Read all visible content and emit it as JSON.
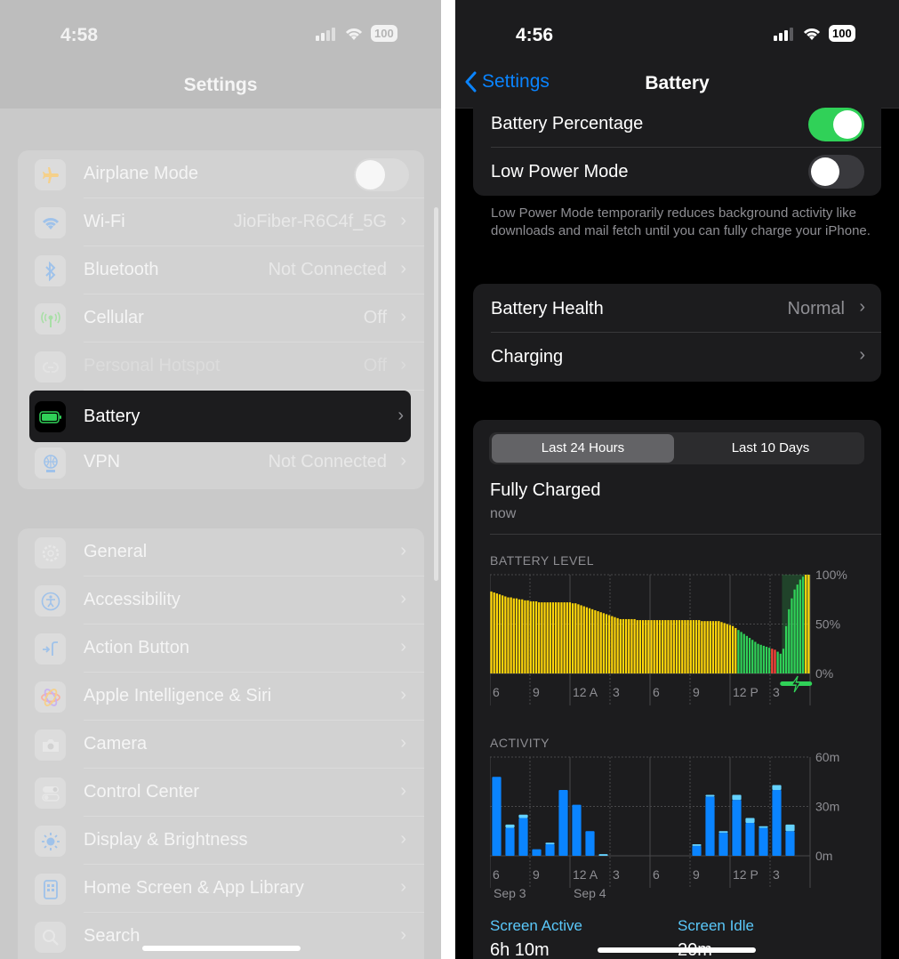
{
  "left": {
    "status": {
      "time": "4:58",
      "battery": "100"
    },
    "title": "Settings",
    "group1": [
      {
        "label": "Airplane Mode",
        "value": "",
        "kind": "toggle-off"
      },
      {
        "label": "Wi-Fi",
        "value": "JioFiber-R6C4f_5G",
        "kind": "chevron"
      },
      {
        "label": "Bluetooth",
        "value": "Not Connected",
        "kind": "chevron"
      },
      {
        "label": "Cellular",
        "value": "Off",
        "kind": "chevron"
      },
      {
        "label": "Personal Hotspot",
        "value": "Off",
        "kind": "chevron-dim"
      },
      {
        "label": "Battery",
        "value": "",
        "kind": "highlight"
      },
      {
        "label": "VPN",
        "value": "Not Connected",
        "kind": "chevron"
      }
    ],
    "group2": [
      {
        "label": "General"
      },
      {
        "label": "Accessibility"
      },
      {
        "label": "Action Button"
      },
      {
        "label": "Apple Intelligence & Siri"
      },
      {
        "label": "Camera"
      },
      {
        "label": "Control Center"
      },
      {
        "label": "Display & Brightness"
      },
      {
        "label": "Home Screen & App Library"
      },
      {
        "label": "Search"
      }
    ],
    "icons": [
      "airplane-icon",
      "wifi-icon",
      "bluetooth-icon",
      "cellular-icon",
      "hotspot-icon",
      "battery-icon",
      "vpn-icon",
      "gear-icon",
      "accessibility-icon",
      "action-button-icon",
      "siri-icon",
      "camera-icon",
      "control-center-icon",
      "brightness-icon",
      "home-screen-icon",
      "search-icon"
    ]
  },
  "right": {
    "status": {
      "time": "4:56",
      "battery": "100"
    },
    "nav": {
      "back": "Settings",
      "title": "Battery"
    },
    "toggles": [
      {
        "label": "Battery Percentage",
        "on": true
      },
      {
        "label": "Low Power Mode",
        "on": false
      }
    ],
    "footnote": "Low Power Mode temporarily reduces background activity like downloads and mail fetch until you can fully charge your iPhone.",
    "health": {
      "label": "Battery Health",
      "value": "Normal"
    },
    "charging": {
      "label": "Charging"
    },
    "segments": {
      "selected": "Last 24 Hours",
      "other": "Last 10 Days"
    },
    "charged": {
      "title": "Fully Charged",
      "subtitle": "now"
    },
    "legend": {
      "active_label": "Screen Active",
      "active_value": "6h 10m",
      "idle_label": "Screen Idle",
      "idle_value": "20m"
    }
  },
  "colors": {
    "accent": "#0a84ff",
    "toggle_on": "#30d158",
    "bar_normal": "#ffd60a",
    "bar_low_power": "#30d158",
    "bar_critical": "#ff453a",
    "activity_active": "#0a84ff",
    "activity_idle": "#64d2ff"
  },
  "chart_data": [
    {
      "type": "bar",
      "title": "BATTERY LEVEL",
      "xlabel": "",
      "ylabel": "",
      "ylim": [
        0,
        100
      ],
      "ytick_labels": [
        "100%",
        "50%",
        "0%"
      ],
      "xtick_labels": [
        "6",
        "9",
        "12 A",
        "3",
        "6",
        "9",
        "12 P",
        "3"
      ],
      "values": [
        83,
        82,
        81,
        80,
        79,
        78,
        77,
        77,
        76,
        76,
        75,
        75,
        74,
        74,
        73,
        73,
        73,
        72,
        72,
        72,
        72,
        72,
        72,
        72,
        72,
        72,
        72,
        72,
        72,
        71,
        71,
        70,
        69,
        68,
        67,
        66,
        65,
        64,
        63,
        62,
        61,
        60,
        59,
        58,
        57,
        56,
        55,
        55,
        55,
        55,
        55,
        55,
        54,
        54,
        54,
        54,
        54,
        54,
        54,
        54,
        54,
        54,
        54,
        54,
        54,
        54,
        54,
        54,
        54,
        54,
        54,
        54,
        54,
        54,
        54,
        53,
        53,
        53,
        53,
        53,
        53,
        53,
        52,
        51,
        50,
        49,
        48,
        46,
        44,
        42,
        40,
        38,
        36,
        34,
        32,
        30,
        29,
        28,
        27,
        26,
        25,
        24,
        22,
        20,
        25,
        48,
        65,
        76,
        85,
        90,
        95,
        98,
        100,
        100
      ],
      "bar_states": [
        "yellow",
        "yellow",
        "yellow",
        "yellow",
        "yellow",
        "yellow",
        "yellow",
        "yellow",
        "yellow",
        "yellow",
        "yellow",
        "yellow",
        "yellow",
        "yellow",
        "yellow",
        "yellow",
        "yellow",
        "yellow",
        "yellow",
        "yellow",
        "yellow",
        "yellow",
        "yellow",
        "yellow",
        "yellow",
        "yellow",
        "yellow",
        "yellow",
        "yellow",
        "yellow",
        "yellow",
        "yellow",
        "yellow",
        "yellow",
        "yellow",
        "yellow",
        "yellow",
        "yellow",
        "yellow",
        "yellow",
        "yellow",
        "yellow",
        "yellow",
        "yellow",
        "yellow",
        "yellow",
        "yellow",
        "yellow",
        "yellow",
        "yellow",
        "yellow",
        "yellow",
        "yellow",
        "yellow",
        "yellow",
        "yellow",
        "yellow",
        "yellow",
        "yellow",
        "yellow",
        "yellow",
        "yellow",
        "yellow",
        "yellow",
        "yellow",
        "yellow",
        "yellow",
        "yellow",
        "yellow",
        "yellow",
        "yellow",
        "yellow",
        "yellow",
        "yellow",
        "yellow",
        "yellow",
        "yellow",
        "yellow",
        "yellow",
        "yellow",
        "yellow",
        "yellow",
        "yellow",
        "yellow",
        "yellow",
        "yellow",
        "yellow",
        "yellow",
        "green",
        "green",
        "green",
        "green",
        "green",
        "green",
        "green",
        "green",
        "green",
        "green",
        "green",
        "green",
        "red",
        "red",
        "green",
        "green",
        "green",
        "green",
        "green",
        "green",
        "green",
        "green",
        "green",
        "green"
      ],
      "charging_indicator": true
    },
    {
      "type": "bar",
      "title": "ACTIVITY",
      "xlabel": "",
      "ylabel": "",
      "ylim": [
        0,
        60
      ],
      "ytick_labels": [
        "60m",
        "30m",
        "0m"
      ],
      "xtick_labels": [
        "6",
        "9",
        "12 A",
        "3",
        "6",
        "9",
        "12 P",
        "3"
      ],
      "date_labels": [
        "Sep 3",
        "Sep 4"
      ],
      "categories": [
        "6",
        "7",
        "8",
        "9",
        "10",
        "11",
        "12",
        "1",
        "2",
        "3",
        "4",
        "5",
        "6",
        "7",
        "8",
        "9",
        "10",
        "11",
        "12",
        "1",
        "2",
        "3",
        "4",
        "5"
      ],
      "series": [
        {
          "name": "Screen Active",
          "values": [
            48,
            17,
            23,
            4,
            7,
            40,
            31,
            15,
            0,
            0,
            0,
            0,
            0,
            0,
            0,
            6,
            36,
            14,
            34,
            20,
            17,
            40,
            15,
            0
          ]
        },
        {
          "name": "Screen Idle",
          "values": [
            0,
            2,
            2,
            0,
            1,
            0,
            0,
            0,
            1,
            0,
            0,
            0,
            0,
            0,
            0,
            1,
            1,
            1,
            3,
            3,
            1,
            3,
            4,
            0
          ]
        }
      ]
    }
  ]
}
